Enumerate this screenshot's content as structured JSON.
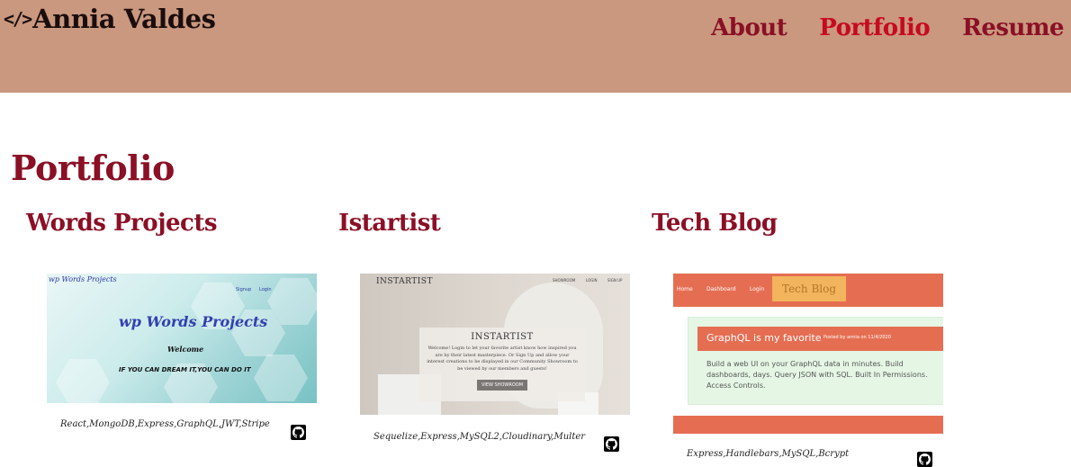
{
  "header": {
    "brand_icon": "</>",
    "brand_name": "Annia Valdes",
    "nav": [
      {
        "label": "About",
        "active": false
      },
      {
        "label": "Portfolio",
        "active": true
      },
      {
        "label": "Resume",
        "active": false
      }
    ]
  },
  "page_title": "Portfolio",
  "projects": [
    {
      "title": "Words Projects",
      "tech": "React,MongoDB,Express,GraphQL,JWT,Stripe",
      "thumb": {
        "small_logo": "wp Words Projects",
        "nav": [
          "Signup",
          "Login"
        ],
        "big_logo": "wp Words Projects",
        "welcome": "Welcome",
        "motto": "IF YOU CAN DREAM IT,YOU CAN DO IT"
      }
    },
    {
      "title": "Istartist",
      "tech": "Sequelize,Express,MySQL2,Cloudinary,Multer",
      "thumb": {
        "logo": "INSTARTIST",
        "nav": [
          "SHOWROOM",
          "LOGIN",
          "SIGN UP"
        ],
        "card_title": "INSTARTIST",
        "card_text": "Welcome! Login to let your favorite artist know how inspired you are by their latest masterpiece. Or Sign Up and allow your interest creations to be displayed in our Community Showroom to be viewed by our members and guests!",
        "card_button": "VIEW SHOWROOM"
      }
    },
    {
      "title": "Tech Blog",
      "tech": "Express,Handlebars,MySQL,Bcrypt",
      "thumb": {
        "nav": [
          "Home",
          "Dashboard",
          "Login"
        ],
        "logo": "Tech Blog",
        "post_title": "GraphQL is my favorite",
        "post_meta": "Posted by annia on 11/4/2020",
        "post_body": "Build a web UI on your GraphQL data in minutes. Build dashboards, days. Query JSON with SQL. Built In Permissions. Access Controls."
      }
    }
  ],
  "icons": {
    "github": "github-icon",
    "code": "code-icon"
  },
  "colors": {
    "header_bg": "#c9987e",
    "accent": "#8b0f25",
    "active": "#c8091f"
  }
}
